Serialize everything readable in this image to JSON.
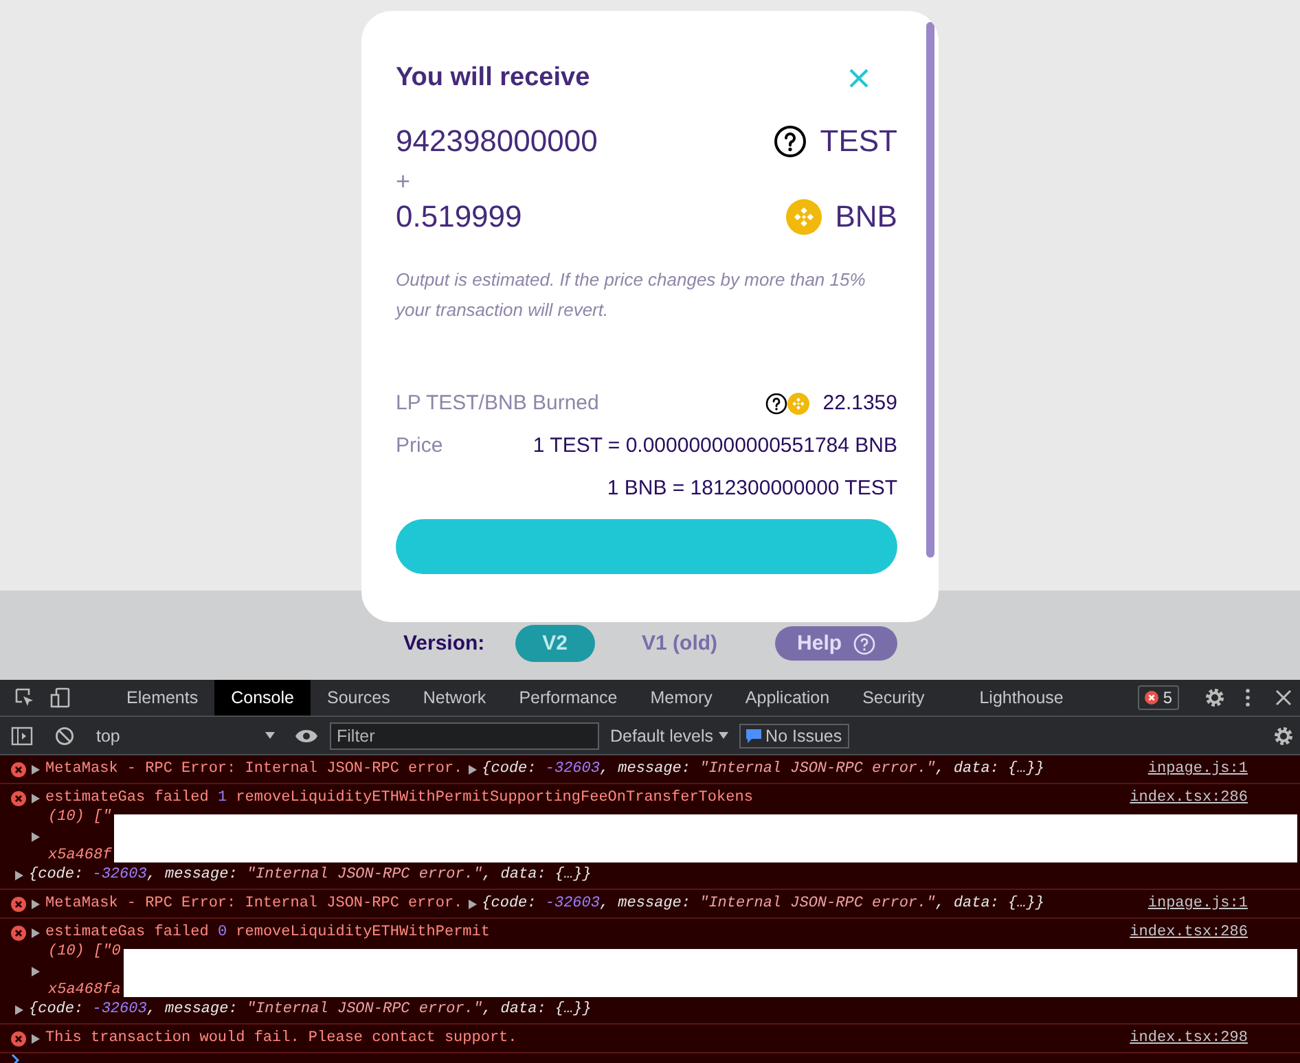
{
  "modal": {
    "title": "You will receive",
    "amounts": [
      {
        "value": "942398000000",
        "symbol": "TEST",
        "kind": "unknown"
      },
      {
        "value": "0.519999",
        "symbol": "BNB",
        "kind": "bnb"
      }
    ],
    "plus": "+",
    "note": "Output is estimated. If the price changes by more than 15% your transaction will revert.",
    "burned_label": "LP TEST/BNB Burned",
    "burned_value": "22.1359",
    "price_label": "Price",
    "prices": [
      "1 TEST = 0.000000000000551784 BNB",
      "1 BNB = 1812300000000 TEST"
    ]
  },
  "version_bar": {
    "label": "Version:",
    "versions": [
      {
        "label": "V2",
        "selected": true
      },
      {
        "label": "V1 (old)",
        "selected": false
      }
    ],
    "help": "Help"
  },
  "devtools": {
    "tabs": [
      {
        "label": "Elements",
        "selected": false
      },
      {
        "label": "Console",
        "selected": true
      },
      {
        "label": "Sources",
        "selected": false
      },
      {
        "label": "Network",
        "selected": false
      },
      {
        "label": "Performance",
        "selected": false
      },
      {
        "label": "Memory",
        "selected": false
      },
      {
        "label": "Application",
        "selected": false
      },
      {
        "label": "Security",
        "selected": false
      },
      {
        "label": "Lighthouse",
        "selected": false
      }
    ],
    "error_count": "5",
    "context": "top",
    "filter_placeholder": "Filter",
    "levels": "Default levels",
    "issues": "No Issues",
    "messages": [
      {
        "kind": "rpc",
        "text": "MetaMask - RPC Error: Internal JSON-RPC error.",
        "object": [
          {
            "text": "{code: ",
            "kind": "plain"
          },
          {
            "text": "-32603",
            "kind": "number"
          },
          {
            "text": ", message: ",
            "kind": "plain"
          },
          {
            "text": "\"Internal JSON-RPC error.\"",
            "kind": "string"
          },
          {
            "text": ", data: {…}}",
            "kind": "plain"
          }
        ],
        "source": "inpage.js:1"
      },
      {
        "kind": "gas",
        "text": "estimateGas failed",
        "number": "1",
        "method": "removeLiquidityETHWithPermitSupportingFeeOnTransferTokens",
        "array_head": "(10) [\"",
        "array_tail": "x5a468f",
        "object": [
          {
            "text": "{code: ",
            "kind": "plain"
          },
          {
            "text": "-32603",
            "kind": "number"
          },
          {
            "text": ", message: ",
            "kind": "plain"
          },
          {
            "text": "\"Internal JSON-RPC error.\"",
            "kind": "string"
          },
          {
            "text": ", data: {…}}",
            "kind": "plain"
          }
        ],
        "source": "index.tsx:286"
      },
      {
        "kind": "rpc",
        "text": "MetaMask - RPC Error: Internal JSON-RPC error.",
        "object": [
          {
            "text": "{code: ",
            "kind": "plain"
          },
          {
            "text": "-32603",
            "kind": "number"
          },
          {
            "text": ", message: ",
            "kind": "plain"
          },
          {
            "text": "\"Internal JSON-RPC error.\"",
            "kind": "string"
          },
          {
            "text": ", data: {…}}",
            "kind": "plain"
          }
        ],
        "source": "inpage.js:1"
      },
      {
        "kind": "gas",
        "text": "estimateGas failed",
        "number": "0",
        "method": "removeLiquidityETHWithPermit",
        "array_head": "(10) [\"0",
        "array_tail": "x5a468fa",
        "object": [
          {
            "text": "{code: ",
            "kind": "plain"
          },
          {
            "text": "-32603",
            "kind": "number"
          },
          {
            "text": ", message: ",
            "kind": "plain"
          },
          {
            "text": "\"Internal JSON-RPC error.\"",
            "kind": "string"
          },
          {
            "text": ", data: {…}}",
            "kind": "plain"
          }
        ],
        "source": "index.tsx:286"
      },
      {
        "kind": "plain",
        "text": "This transaction would fail. Please contact support.",
        "source": "index.tsx:298"
      }
    ]
  }
}
